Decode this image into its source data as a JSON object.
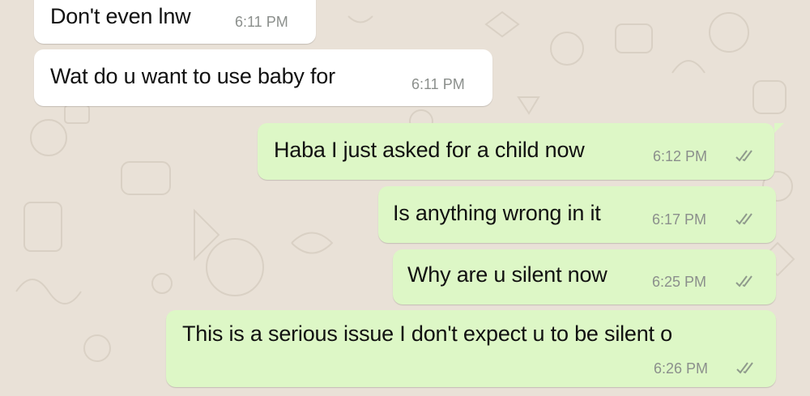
{
  "messages": [
    {
      "direction": "incoming",
      "text": "Don't even lnw",
      "time": "6:11 PM"
    },
    {
      "direction": "incoming",
      "text": "Wat do u want to use baby for",
      "time": "6:11 PM"
    },
    {
      "direction": "outgoing",
      "text": "Haba I just asked for a child now",
      "time": "6:12 PM",
      "status_icon": "double-check-icon"
    },
    {
      "direction": "outgoing",
      "text": "Is anything wrong in it",
      "time": "6:17 PM",
      "status_icon": "double-check-icon"
    },
    {
      "direction": "outgoing",
      "text": "Why are u silent now",
      "time": "6:25 PM",
      "status_icon": "double-check-icon"
    },
    {
      "direction": "outgoing",
      "text": "This is a serious issue I don't expect u to be silent o",
      "time": "6:26 PM",
      "status_icon": "double-check-icon"
    }
  ],
  "colors": {
    "wallpaper": "#e9e1d7",
    "incoming_bubble": "#ffffff",
    "outgoing_bubble": "#ddf7c6",
    "timestamp": "#8b8f8c",
    "ticks": "#8f9a8c"
  }
}
